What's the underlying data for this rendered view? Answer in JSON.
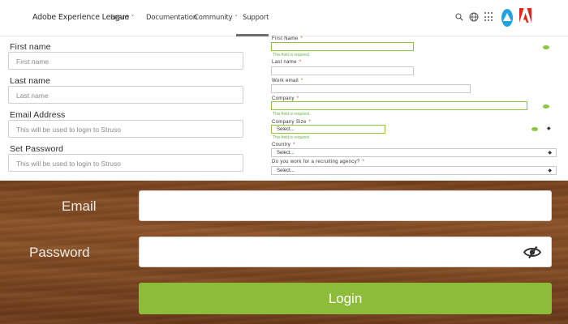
{
  "nav": {
    "brand": "Adobe Experience League",
    "items": [
      {
        "label": "Learn",
        "chevron": "˅"
      },
      {
        "label": "Documentation"
      },
      {
        "label": "Community",
        "chevron": "˅"
      },
      {
        "label": "Support"
      }
    ],
    "active_item": "Support",
    "icons": [
      "search-icon",
      "globe-icon",
      "apps-grid-icon",
      "avatar",
      "adobe-logo"
    ]
  },
  "left_form": {
    "fields": [
      {
        "label": "First name",
        "placeholder": "First name"
      },
      {
        "label": "Last name",
        "placeholder": "Last name"
      },
      {
        "label": "Email Address",
        "placeholder": "This will be used to login to Struso"
      },
      {
        "label": "Set Password",
        "placeholder": "This will be used to login to Struso"
      }
    ]
  },
  "right_form": {
    "required_mark": "*",
    "first_name": {
      "label": "First Name",
      "error": "This field is required."
    },
    "last_name": {
      "label": "Last name"
    },
    "work_email": {
      "label": "Work email"
    },
    "company": {
      "label": "Company",
      "error": "This field is required."
    },
    "company_size": {
      "label": "Company Size",
      "value": "Select...",
      "error": "This field is required."
    },
    "country": {
      "label": "Country",
      "value": "Select..."
    },
    "recruiting": {
      "label": "Do you work for a recruiting agency?",
      "value": "Select..."
    },
    "valid_color": "#8cc63f"
  },
  "login": {
    "email_label": "Email",
    "password_label": "Password",
    "button_label": "Login",
    "button_color": "#8dbb3a",
    "password_toggle_icon": "eye-slash-icon"
  }
}
